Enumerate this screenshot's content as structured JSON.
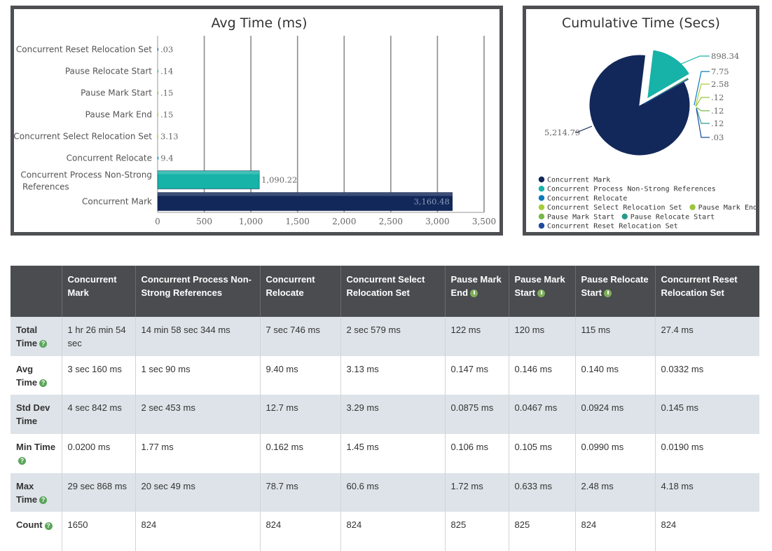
{
  "avg_chart": {
    "title": "Avg Time (ms)",
    "chart_data": {
      "type": "bar",
      "orientation": "horizontal",
      "title": "Avg Time (ms)",
      "categories": [
        "Concurrent Reset Relocation Set",
        "Pause Relocate Start",
        "Pause Mark Start",
        "Pause Mark End",
        "Concurrent Select Relocation Set",
        "Concurrent Relocate",
        "Concurrent Process Non-Strong References",
        "Concurrent Mark"
      ],
      "values": [
        0.03,
        0.14,
        0.15,
        0.15,
        3.13,
        9.4,
        1090.22,
        3160.48
      ],
      "value_labels": [
        ".03",
        ".14",
        ".15",
        ".15",
        "3.13",
        "9.4",
        "1,090.22",
        "3,160.48"
      ],
      "colors": [
        "#1e4a9e",
        "#2aa198",
        "#79b74a",
        "#9bc53d",
        "#a8cc3a",
        "#0b7ab8",
        "#17b2a8",
        "#12285a"
      ],
      "xlim": [
        0,
        3500
      ],
      "ticks": [
        0,
        500,
        1000,
        1500,
        2000,
        2500,
        3000,
        3500
      ],
      "tick_labels": [
        "0",
        "500",
        "1,000",
        "1,500",
        "2,000",
        "2,500",
        "3,000",
        "3,500"
      ],
      "grid": true
    }
  },
  "cum_chart": {
    "title": "Cumulative Time (Secs)",
    "chart_data": {
      "type": "pie",
      "title": "Cumulative Time (Secs)",
      "labels": [
        "Concurrent Mark",
        "Concurrent Process Non-Strong References",
        "Concurrent Relocate",
        "Concurrent Select Relocation Set",
        "Pause Mark End",
        "Pause Mark Start",
        "Pause Relocate Start",
        "Concurrent Reset Relocation Set"
      ],
      "values": [
        5214.79,
        898.34,
        7.75,
        2.58,
        0.12,
        0.12,
        0.12,
        0.03
      ],
      "value_labels": [
        "5,214.79",
        "898.34",
        "7.75",
        "2.58",
        ".12",
        ".12",
        ".12",
        ".03"
      ],
      "colors": [
        "#12285a",
        "#17b2a8",
        "#0b7ab8",
        "#a8cc3a",
        "#9bc53d",
        "#79b74a",
        "#2a9a8a",
        "#1e4a9e"
      ],
      "legend_position": "bottom"
    }
  },
  "table": {
    "columns": [
      "",
      "Concurrent Mark",
      "Concurrent Process Non-Strong References",
      "Concurrent Relocate",
      "Concurrent Select Relocation Set",
      "Pause Mark End",
      "Pause Mark Start",
      "Pause Relocate Start",
      "Concurrent Reset Relocation Set"
    ],
    "rows": [
      {
        "label": "Total Time",
        "help": true,
        "cells": [
          "1 hr 26 min 54 sec",
          "14 min 58 sec 344 ms",
          "7 sec 746 ms",
          "2 sec 579 ms",
          "122 ms",
          "120 ms",
          "115 ms",
          "27.4 ms"
        ]
      },
      {
        "label": "Avg Time",
        "help": true,
        "cells": [
          "3 sec 160 ms",
          "1 sec 90 ms",
          "9.40 ms",
          "3.13 ms",
          "0.147 ms",
          "0.146 ms",
          "0.140 ms",
          "0.0332 ms"
        ]
      },
      {
        "label": "Std Dev Time",
        "help": false,
        "cells": [
          "4 sec 842 ms",
          "2 sec 453 ms",
          "12.7 ms",
          "3.29 ms",
          "0.0875 ms",
          "0.0467 ms",
          "0.0924 ms",
          "0.145 ms"
        ]
      },
      {
        "label": "Min Time",
        "help": true,
        "cells": [
          "0.0200 ms",
          "1.77 ms",
          "0.162 ms",
          "1.45 ms",
          "0.106 ms",
          "0.105 ms",
          "0.0990 ms",
          "0.0190 ms"
        ]
      },
      {
        "label": "Max Time",
        "help": true,
        "cells": [
          "29 sec 868 ms",
          "20 sec 49 ms",
          "78.7 ms",
          "60.6 ms",
          "1.72 ms",
          "0.633 ms",
          "2.48 ms",
          "4.18 ms"
        ]
      },
      {
        "label": "Count",
        "help": true,
        "cells": [
          "1650",
          "824",
          "824",
          "824",
          "825",
          "825",
          "824",
          "824"
        ]
      }
    ],
    "header_help_columns": [
      "Pause Mark End",
      "Pause Mark Start",
      "Pause Relocate Start"
    ],
    "help_icon": "question-circle-icon",
    "pause_icon": "pause-circle-icon"
  }
}
